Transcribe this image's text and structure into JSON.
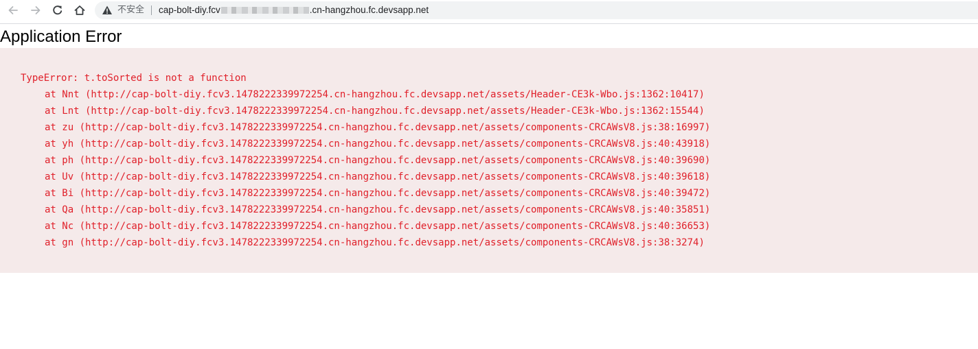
{
  "browser": {
    "security_label": "不安全",
    "url_prefix": "cap-bolt-diy.fcv",
    "url_suffix": ".cn-hangzhou.fc.devsapp.net"
  },
  "page": {
    "title": "Application Error"
  },
  "error": {
    "message": "TypeError: t.toSorted is not a function",
    "frames": [
      "at Nnt (http://cap-bolt-diy.fcv3.1478222339972254.cn-hangzhou.fc.devsapp.net/assets/Header-CE3k-Wbo.js:1362:10417)",
      "at Lnt (http://cap-bolt-diy.fcv3.1478222339972254.cn-hangzhou.fc.devsapp.net/assets/Header-CE3k-Wbo.js:1362:15544)",
      "at zu (http://cap-bolt-diy.fcv3.1478222339972254.cn-hangzhou.fc.devsapp.net/assets/components-CRCAWsV8.js:38:16997)",
      "at yh (http://cap-bolt-diy.fcv3.1478222339972254.cn-hangzhou.fc.devsapp.net/assets/components-CRCAWsV8.js:40:43918)",
      "at ph (http://cap-bolt-diy.fcv3.1478222339972254.cn-hangzhou.fc.devsapp.net/assets/components-CRCAWsV8.js:40:39690)",
      "at Uv (http://cap-bolt-diy.fcv3.1478222339972254.cn-hangzhou.fc.devsapp.net/assets/components-CRCAWsV8.js:40:39618)",
      "at Bi (http://cap-bolt-diy.fcv3.1478222339972254.cn-hangzhou.fc.devsapp.net/assets/components-CRCAWsV8.js:40:39472)",
      "at Qa (http://cap-bolt-diy.fcv3.1478222339972254.cn-hangzhou.fc.devsapp.net/assets/components-CRCAWsV8.js:40:35851)",
      "at Nc (http://cap-bolt-diy.fcv3.1478222339972254.cn-hangzhou.fc.devsapp.net/assets/components-CRCAWsV8.js:40:36653)",
      "at gn (http://cap-bolt-diy.fcv3.1478222339972254.cn-hangzhou.fc.devsapp.net/assets/components-CRCAWsV8.js:38:3274)"
    ]
  },
  "icons": {
    "back": "arrow-left-icon",
    "forward": "arrow-right-icon",
    "reload": "reload-icon",
    "home": "home-icon",
    "security": "warning-triangle-icon"
  },
  "colors": {
    "error_text": "#e0202a",
    "error_background": "#f5eaea",
    "omnibox_background": "#f1f3f4"
  }
}
